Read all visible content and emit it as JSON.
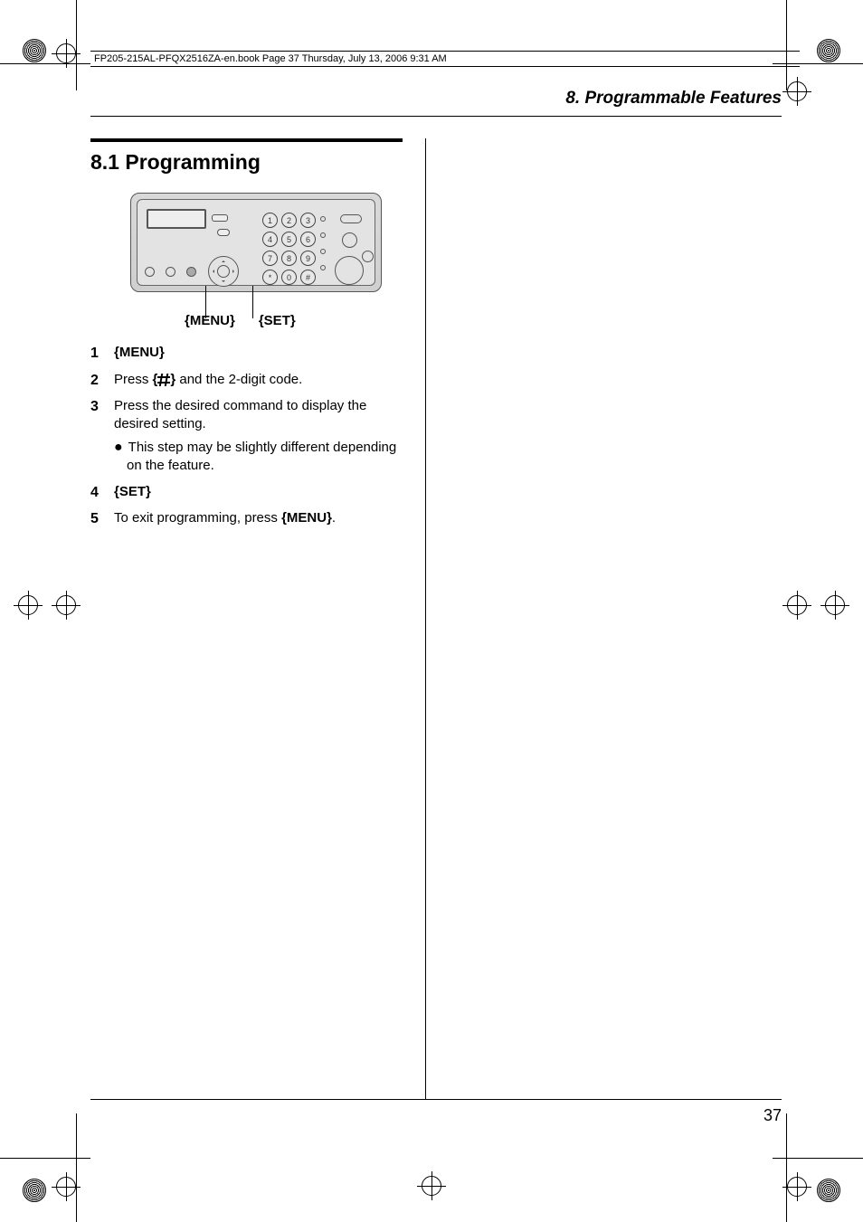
{
  "book_header": "FP205-215AL-PFQX2516ZA-en.book  Page 37  Thursday, July 13, 2006  9:31 AM",
  "running_head": "8. Programmable Features",
  "section_title": "8.1 Programming",
  "diagram": {
    "label_menu": "{MENU}",
    "label_set": "{SET}",
    "keys": [
      "1",
      "2",
      "3",
      "4",
      "5",
      "6",
      "7",
      "8",
      "9",
      "*",
      "0",
      "#"
    ]
  },
  "steps": [
    {
      "n": "1",
      "body_bold": "{MENU}"
    },
    {
      "n": "2",
      "pre": "Press ",
      "after_hash": " and the 2-digit code."
    },
    {
      "n": "3",
      "body": "Press the desired command to display the desired setting.",
      "sub": "This step may be slightly different depending on the feature."
    },
    {
      "n": "4",
      "body_bold": "{SET}"
    },
    {
      "n": "5",
      "pre": "To exit programming, press ",
      "body_bold": "{MENU}",
      "post": "."
    }
  ],
  "page_number": "37"
}
